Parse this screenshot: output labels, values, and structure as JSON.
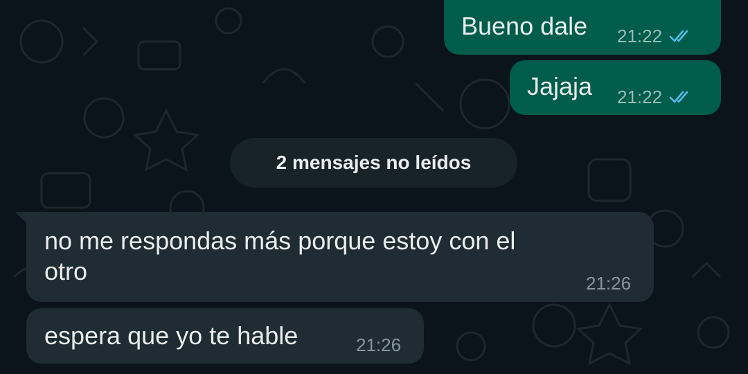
{
  "chat": {
    "outgoing": [
      {
        "text": "Bueno dale",
        "time": "21:22",
        "status_icon": "double-check-read-icon"
      },
      {
        "text": "Jajaja",
        "time": "21:22",
        "status_icon": "double-check-read-icon"
      }
    ],
    "unread_banner": "2 mensajes no leídos",
    "incoming": [
      {
        "text": "no me respondas más porque estoy con el\notro",
        "time": "21:26"
      },
      {
        "text": "espera que yo te hable",
        "time": "21:26"
      }
    ]
  },
  "colors": {
    "background": "#0b141a",
    "outgoing_bubble": "#005c4b",
    "incoming_bubble": "#202c33",
    "tick_read": "#53bdeb"
  }
}
